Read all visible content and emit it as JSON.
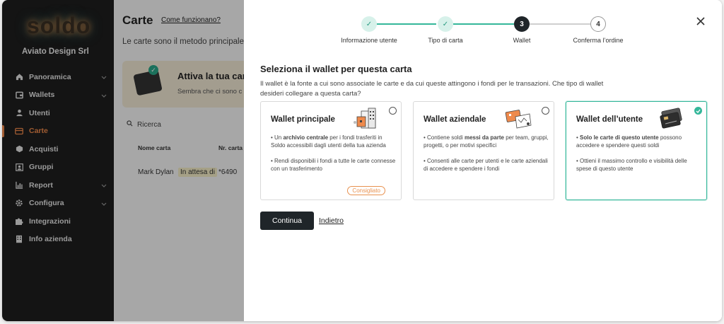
{
  "sidebar": {
    "logo": "soldo",
    "company": "Aviato Design Srl",
    "items": [
      {
        "label": "Panoramica",
        "icon": "home-icon",
        "chevron": true
      },
      {
        "label": "Wallets",
        "icon": "wallet-icon",
        "chevron": true
      },
      {
        "label": "Utenti",
        "icon": "user-icon",
        "chevron": false
      },
      {
        "label": "Carte",
        "icon": "card-icon",
        "chevron": false,
        "active": true
      },
      {
        "label": "Acquisti",
        "icon": "purchase-icon",
        "chevron": false
      },
      {
        "label": "Gruppi",
        "icon": "group-icon",
        "chevron": false
      },
      {
        "label": "Report",
        "icon": "chart-icon",
        "chevron": true
      },
      {
        "label": "Configura",
        "icon": "gear-icon",
        "chevron": true
      },
      {
        "label": "Integrazioni",
        "icon": "puzzle-icon",
        "chevron": false
      },
      {
        "label": "Info azienda",
        "icon": "building-icon",
        "chevron": false
      }
    ]
  },
  "main": {
    "title": "Carte",
    "help_link": "Come funzionano?",
    "description": "Le carte sono il metodo principale d",
    "banner_title": "Attiva la tua cart",
    "banner_sub": "Sembra che ci sono c",
    "search_placeholder": "Ricerca",
    "columns": [
      "Nome carta",
      "Nr. carta"
    ],
    "row": {
      "name": "Mark Dylan",
      "status": "In attesa di",
      "number": "*6490"
    }
  },
  "modal": {
    "steps": [
      {
        "label": "Informazione utente",
        "state": "done",
        "symbol": "✓"
      },
      {
        "label": "Tipo di carta",
        "state": "done",
        "symbol": "✓"
      },
      {
        "label": "Wallet",
        "state": "current",
        "symbol": "3"
      },
      {
        "label": "Conferma l’ordine",
        "state": "todo",
        "symbol": "4"
      }
    ],
    "heading": "Seleziona il wallet per questa carta",
    "description": "Il wallet è la fonte a cui sono associate le carte e da cui queste attingono i fondi per le transazioni. Che tipo di wallet desideri collegare a questa carta?",
    "cards": [
      {
        "title": "Wallet principale",
        "p1_pre": "• Un ",
        "p1_bold": "archivio centrale",
        "p1_post": " per i fondi trasferiti in Soldo accessibili dagli utenti della tua azienda",
        "p2": "• Rendi disponibili i fondi a tutte le carte connesse con un trasferimento",
        "badge": "Consigliato",
        "selected": false
      },
      {
        "title": "Wallet aziendale",
        "p1_pre": "• Contiene soldi ",
        "p1_bold": "messi da parte",
        "p1_post": " per team, gruppi, progetti, o per motivi specifici",
        "p2": "• Consenti alle carte per utenti e le carte aziendali di accedere e spendere i fondi",
        "selected": false
      },
      {
        "title": "Wallet dell’utente",
        "p1_pre": "• ",
        "p1_bold": "Solo le carte di questo utente",
        "p1_post": " possono accedere e spendere questi soldi",
        "p2": "• Ottieni il massimo controllo e visibilità delle spese di questo utente",
        "selected": true
      }
    ],
    "continue_label": "Continua",
    "back_label": "Indietro"
  },
  "colors": {
    "accent": "#35b79a",
    "active_nav": "#f08a4b",
    "step_done_bg": "#d7f1ea",
    "primary_button": "#1f2529"
  }
}
